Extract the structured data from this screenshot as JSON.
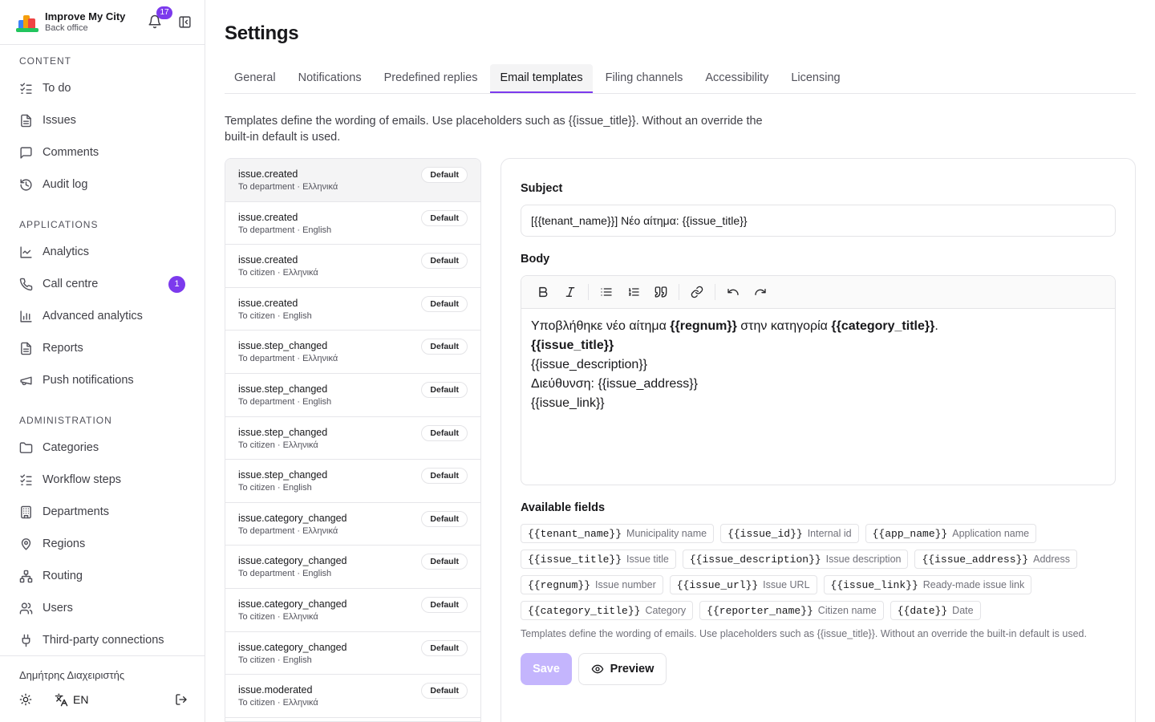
{
  "brand": {
    "name": "Improve My City",
    "subtitle": "Back office",
    "notifications_count": "17"
  },
  "sidebar": {
    "sections": [
      {
        "title": "CONTENT",
        "items": [
          {
            "label": "To do",
            "icon": "checklist-icon"
          },
          {
            "label": "Issues",
            "icon": "document-icon"
          },
          {
            "label": "Comments",
            "icon": "comment-icon"
          },
          {
            "label": "Audit log",
            "icon": "history-icon"
          }
        ]
      },
      {
        "title": "APPLICATIONS",
        "items": [
          {
            "label": "Analytics",
            "icon": "line-chart-icon"
          },
          {
            "label": "Call centre",
            "icon": "phone-icon",
            "badge": "1"
          },
          {
            "label": "Advanced analytics",
            "icon": "bar-chart-icon"
          },
          {
            "label": "Reports",
            "icon": "document-icon"
          },
          {
            "label": "Push notifications",
            "icon": "megaphone-icon"
          }
        ]
      },
      {
        "title": "ADMINISTRATION",
        "items": [
          {
            "label": "Categories",
            "icon": "folder-icon"
          },
          {
            "label": "Workflow steps",
            "icon": "checklist-icon"
          },
          {
            "label": "Departments",
            "icon": "building-icon"
          },
          {
            "label": "Regions",
            "icon": "map-pin-icon"
          },
          {
            "label": "Routing",
            "icon": "network-icon"
          },
          {
            "label": "Users",
            "icon": "users-icon"
          },
          {
            "label": "Third-party connections",
            "icon": "plug-icon"
          }
        ]
      }
    ],
    "footer": {
      "user": "Δημήτρης Διαχειριστής",
      "language": "EN"
    }
  },
  "page": {
    "title": "Settings",
    "tabs": [
      "General",
      "Notifications",
      "Predefined replies",
      "Email templates",
      "Filing channels",
      "Accessibility",
      "Licensing"
    ],
    "active_tab": "Email templates",
    "intro": "Templates define the wording of emails. Use placeholders such as {{issue_title}}. Without an override the built-in default is used."
  },
  "templates": [
    {
      "key": "issue.created",
      "meta": "To department · Ελληνικά",
      "badge": "Default",
      "selected": true
    },
    {
      "key": "issue.created",
      "meta": "To department · English",
      "badge": "Default"
    },
    {
      "key": "issue.created",
      "meta": "To citizen · Ελληνικά",
      "badge": "Default"
    },
    {
      "key": "issue.created",
      "meta": "To citizen · English",
      "badge": "Default"
    },
    {
      "key": "issue.step_changed",
      "meta": "To department · Ελληνικά",
      "badge": "Default"
    },
    {
      "key": "issue.step_changed",
      "meta": "To department · English",
      "badge": "Default"
    },
    {
      "key": "issue.step_changed",
      "meta": "To citizen · Ελληνικά",
      "badge": "Default"
    },
    {
      "key": "issue.step_changed",
      "meta": "To citizen · English",
      "badge": "Default"
    },
    {
      "key": "issue.category_changed",
      "meta": "To department · Ελληνικά",
      "badge": "Default"
    },
    {
      "key": "issue.category_changed",
      "meta": "To department · English",
      "badge": "Default"
    },
    {
      "key": "issue.category_changed",
      "meta": "To citizen · Ελληνικά",
      "badge": "Default"
    },
    {
      "key": "issue.category_changed",
      "meta": "To citizen · English",
      "badge": "Default"
    },
    {
      "key": "issue.moderated",
      "meta": "To citizen · Ελληνικά",
      "badge": "Default"
    }
  ],
  "editor": {
    "subject_label": "Subject",
    "subject_value": "[{{tenant_name}}] Νέο αίτημα: {{issue_title}}",
    "body_label": "Body",
    "body": {
      "l1_a": "Υποβλήθηκε νέο αίτημα ",
      "l1_b": "{{regnum}}",
      "l1_c": " στην κατηγορία ",
      "l1_d": "{{category_title}}",
      "l1_e": ".",
      "l2": "{{issue_title}}",
      "l3": "{{issue_description}}",
      "l4": "Διεύθυνση: {{issue_address}}",
      "l5": "{{issue_link}}"
    },
    "fields_label": "Available fields",
    "fields": [
      {
        "code": "{{tenant_name}}",
        "desc": "Municipality name"
      },
      {
        "code": "{{issue_id}}",
        "desc": "Internal id"
      },
      {
        "code": "{{app_name}}",
        "desc": "Application name"
      },
      {
        "code": "{{issue_title}}",
        "desc": "Issue title"
      },
      {
        "code": "{{issue_description}}",
        "desc": "Issue description"
      },
      {
        "code": "{{issue_address}}",
        "desc": "Address"
      },
      {
        "code": "{{regnum}}",
        "desc": "Issue number"
      },
      {
        "code": "{{issue_url}}",
        "desc": "Issue URL"
      },
      {
        "code": "{{issue_link}}",
        "desc": "Ready-made issue link"
      },
      {
        "code": "{{category_title}}",
        "desc": "Category"
      },
      {
        "code": "{{reporter_name}}",
        "desc": "Citizen name"
      },
      {
        "code": "{{date}}",
        "desc": "Date"
      }
    ],
    "hint": "Templates define the wording of emails. Use placeholders such as {{issue_title}}. Without an override the built-in default is used.",
    "save_label": "Save",
    "preview_label": "Preview"
  },
  "colors": {
    "accent": "#7c3aed",
    "save_disabled": "#c4b5fd"
  }
}
